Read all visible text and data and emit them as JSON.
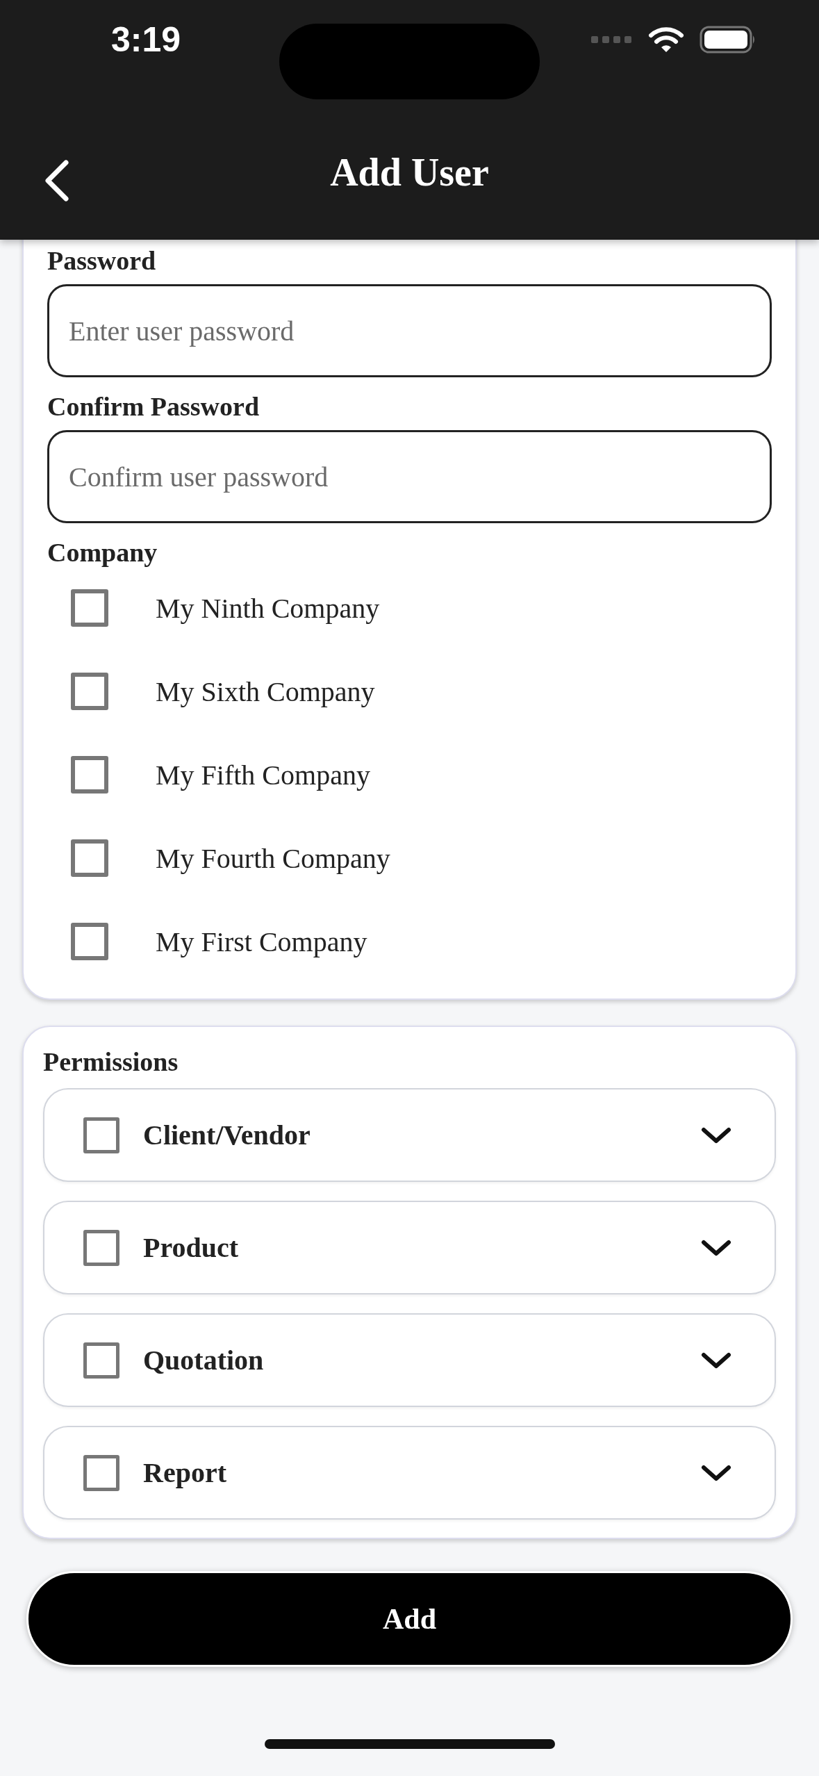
{
  "status_bar": {
    "time": "3:19"
  },
  "header": {
    "title": "Add User"
  },
  "fields": [
    {
      "label": "Password",
      "placeholder": "Enter user password"
    },
    {
      "label": "Confirm Password",
      "placeholder": "Confirm user password"
    }
  ],
  "company": {
    "label": "Company",
    "options": [
      {
        "name": "My Ninth Company",
        "checked": false
      },
      {
        "name": "My Sixth Company",
        "checked": false
      },
      {
        "name": "My Fifth Company",
        "checked": false
      },
      {
        "name": "My Fourth Company",
        "checked": false
      },
      {
        "name": "My First Company",
        "checked": false
      }
    ]
  },
  "permissions": {
    "title": "Permissions",
    "items": [
      {
        "name": "Client/Vendor",
        "checked": false,
        "expanded": false
      },
      {
        "name": "Product",
        "checked": false,
        "expanded": false
      },
      {
        "name": "Quotation",
        "checked": false,
        "expanded": false
      },
      {
        "name": "Report",
        "checked": false,
        "expanded": false
      }
    ]
  },
  "add_button": "Add"
}
